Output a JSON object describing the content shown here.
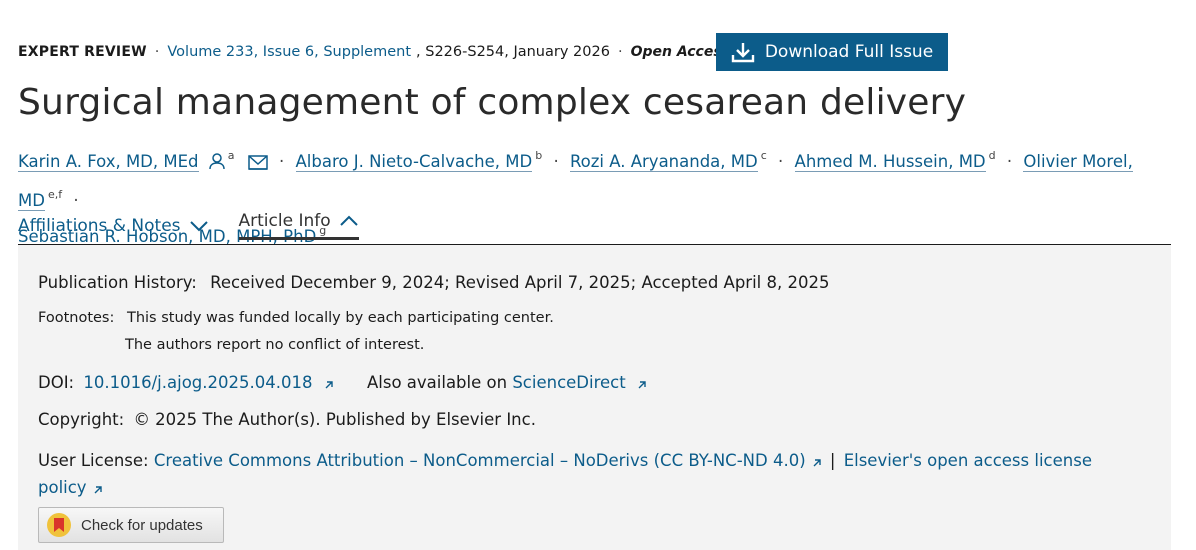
{
  "meta": {
    "article_type": "EXPERT REVIEW",
    "issue_link": "Volume 233, Issue 6, Supplement",
    "pages_date": ", S226-S254, January 2026",
    "open_access": "Open Access",
    "download_label": "Download Full Issue"
  },
  "title": "Surgical management of complex cesarean delivery",
  "authors": [
    {
      "name": "Karin A. Fox, MD, MEd",
      "sup": "a"
    },
    {
      "name": "Albaro J. Nieto-Calvache, MD",
      "sup": "b"
    },
    {
      "name": "Rozi A. Aryananda, MD",
      "sup": "c"
    },
    {
      "name": "Ahmed M. Hussein, MD",
      "sup": "d"
    },
    {
      "name": "Olivier Morel, MD",
      "sup": "e,f"
    },
    {
      "name": "Sebastian R. Hobson, MD, MPH, PhD",
      "sup": "g"
    }
  ],
  "tabs": {
    "affiliations": "Affiliations & Notes",
    "article_info": "Article Info"
  },
  "info": {
    "history_label": "Publication History:",
    "history_value": "Received December 9, 2024; Revised April 7, 2025; Accepted April 8, 2025",
    "footnotes_label": "Footnotes:",
    "footnote_1": "This study was funded locally by each participating center.",
    "footnote_2": "The authors report no conflict of interest.",
    "doi_label": "DOI:",
    "doi_value": "10.1016/j.ajog.2025.04.018",
    "also_label": "Also available on",
    "also_link": "ScienceDirect",
    "copyright_label": "Copyright:",
    "copyright_value": "© 2025 The Author(s). Published by Elsevier Inc.",
    "license_label": "User License:",
    "license_link": "Creative Commons Attribution – NonCommercial – NoDerivs (CC BY-NC-ND 4.0)",
    "license_sep": "|",
    "license_link2_a": "Elsevier's open access license",
    "license_link2_b": "policy"
  },
  "check_updates": "Check for updates",
  "colors": {
    "accent": "#0c5c8a",
    "panel": "#f3f3f3"
  }
}
